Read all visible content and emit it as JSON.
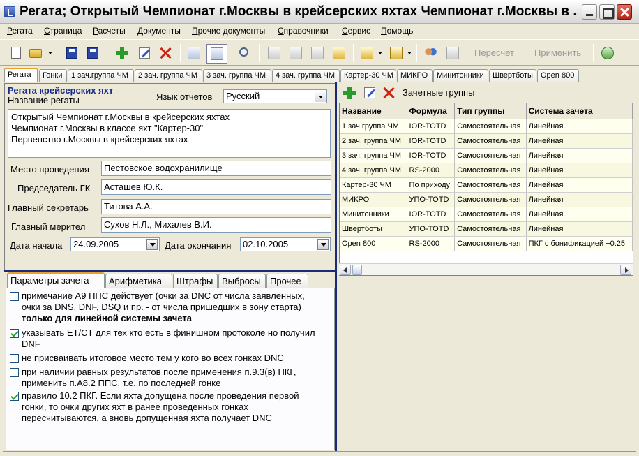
{
  "window": {
    "title": "Регата; Открытый Чемпионат г.Москвы в крейсерских яхтах Чемпионат г.Москвы в ..."
  },
  "menu": [
    "Регата",
    "Страница",
    "Расчеты",
    "Документы",
    "Прочие документы",
    "Справочники",
    "Сервис",
    "Помощь"
  ],
  "toolbar": {
    "recalc_label": "Пересчет",
    "apply_label": "Применить"
  },
  "main_tabs": [
    "Регата",
    "Гонки",
    "1 зач.группа ЧМ",
    "2 зач. группа ЧМ",
    "3 зач. группа ЧМ",
    "4 зач. группа ЧМ",
    "Картер-30 ЧМ",
    "МИКРО",
    "Минитонники",
    "Швертботы",
    "Open 800"
  ],
  "regatta": {
    "heading": "Регата крейсерских яхт",
    "name_label": "Название регаты",
    "language_label": "Язык отчетов",
    "language_value": "Русский",
    "name_lines": [
      "Открытый Чемпионат г.Москвы в крейсерских яхтах",
      "Чемпионат г.Москвы в классе яхт \"Картер-30\"",
      "Первенство г.Москвы в крейсерских яхтах"
    ],
    "venue_label": "Место проведения",
    "venue_value": "Пестовское водохранилище",
    "chairman_label": "Председатель ГК",
    "chairman_value": "Асташев Ю.К.",
    "secretary_label": "Главный секретарь",
    "secretary_value": "Титова А.А.",
    "measurer_label": "Главный мерител",
    "measurer_value": "Сухов Н.Л., Михалев В.И.",
    "start_date_label": "Дата начала",
    "start_date_value": "24.09.2005",
    "end_date_label": "Дата окончания",
    "end_date_value": "02.10.2005"
  },
  "sub_tabs": [
    "Параметры зачета",
    "Арифметика",
    "Штрафы",
    "Выбросы",
    "Прочее"
  ],
  "params": [
    {
      "checked": false,
      "text": "примечание А9 ППС действует (очки за DNC от числа заявленных, очки за DNS, DNF, DSQ и пр. - от числа пришедших в зону старта)",
      "bold_suffix": "только для линейной системы зачета"
    },
    {
      "checked": true,
      "text": "указывать ET/CT для тех кто есть в финишном протоколе но получил DNF",
      "bold_suffix": ""
    },
    {
      "checked": false,
      "text": "не присваивать итоговое место тем у кого во всех гонках DNC",
      "bold_suffix": ""
    },
    {
      "checked": false,
      "text": "при наличии равных результатов после применения п.9.3(в) ПКГ, применить п.А8.2 ППС, т.е. по последней гонке",
      "bold_suffix": ""
    },
    {
      "checked": true,
      "text": "правило 10.2 ПКГ. Если яхта допущена после проведения первой гонки, то очки других яхт в ранее проведенных гонках пересчитываются, а вновь допущенная яхта получает DNC",
      "bold_suffix": ""
    }
  ],
  "groups": {
    "title": "Зачетные группы",
    "columns": [
      "Название",
      "Формула",
      "Тип группы",
      "Система зачета"
    ],
    "rows": [
      [
        "1 зач.группа ЧМ",
        "IOR-TOTD",
        "Самостоятельная",
        "Линейная"
      ],
      [
        "2 зач. группа ЧМ",
        "IOR-TOTD",
        "Самостоятельная",
        "Линейная"
      ],
      [
        "3 зач. группа ЧМ",
        "IOR-TOTD",
        "Самостоятельная",
        "Линейная"
      ],
      [
        "4 зач. группа ЧМ",
        "RS-2000",
        "Самостоятельная",
        "Линейная"
      ],
      [
        "Картер-30 ЧМ",
        "По приходу",
        "Самостоятельная",
        "Линейная"
      ],
      [
        "МИКРО",
        "УПО-TOTD",
        "Самостоятельная",
        "Линейная"
      ],
      [
        "Минитонники",
        "IOR-TOTD",
        "Самостоятельная",
        "Линейная"
      ],
      [
        "Швертботы",
        "УПО-TOTD",
        "Самостоятельная",
        "Линейная"
      ],
      [
        "Open 800",
        "RS-2000",
        "Самостоятельная",
        "ПКГ с бонификацией +0.25"
      ]
    ]
  }
}
